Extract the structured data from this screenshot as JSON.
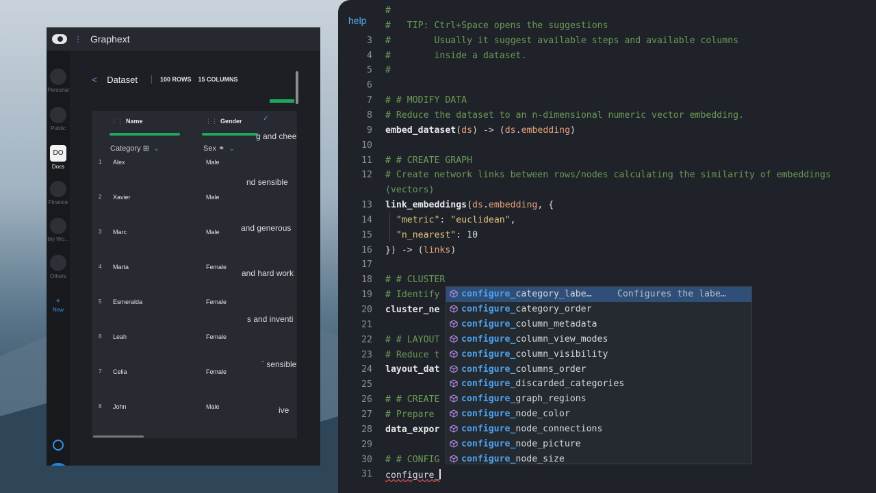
{
  "app": {
    "title": "Graphext",
    "nav": [
      {
        "label": "Personal"
      },
      {
        "label": "Public"
      },
      {
        "label": "Docs",
        "badge": "DO"
      },
      {
        "label": "Finance"
      },
      {
        "label": "My Wo..."
      },
      {
        "label": "Others"
      },
      {
        "label": "New"
      }
    ],
    "help_button": "?"
  },
  "dataset": {
    "back": "<",
    "title": "Dataset",
    "rows": "100 ROWS",
    "columns": "15 COLUMNS",
    "col_headers": [
      {
        "name": "Name",
        "type": "Category"
      },
      {
        "name": "Gender",
        "type": "Sex"
      }
    ],
    "rows_data": [
      {
        "idx": "1",
        "name": "Alex",
        "sex": "Male"
      },
      {
        "idx": "2",
        "name": "Xavier",
        "sex": "Male"
      },
      {
        "idx": "3",
        "name": "Marc",
        "sex": "Male"
      },
      {
        "idx": "4",
        "name": "Marta",
        "sex": "Female"
      },
      {
        "idx": "5",
        "name": "Esmeralda",
        "sex": "Female"
      },
      {
        "idx": "6",
        "name": "Leah",
        "sex": "Female"
      },
      {
        "idx": "7",
        "name": "Celia",
        "sex": "Female"
      },
      {
        "idx": "8",
        "name": "John",
        "sex": "Male"
      }
    ],
    "overflow_texts": [
      "g and chee",
      "nd sensible",
      "and generous",
      "and hard work",
      "s and inventi",
      "` sensible",
      "ive"
    ]
  },
  "editor": {
    "help": "help",
    "lines": [
      {
        "n": "",
        "parts": [
          {
            "c": "cm",
            "t": "#"
          }
        ]
      },
      {
        "n": "",
        "parts": [
          {
            "c": "cm",
            "t": "#   TIP: Ctrl+Space opens the suggestions"
          }
        ]
      },
      {
        "n": "3",
        "parts": [
          {
            "c": "cm",
            "t": "#        Usually it suggest available steps and available columns"
          }
        ]
      },
      {
        "n": "4",
        "parts": [
          {
            "c": "cm",
            "t": "#        inside a dataset."
          }
        ]
      },
      {
        "n": "5",
        "parts": [
          {
            "c": "cm",
            "t": "#"
          }
        ]
      },
      {
        "n": "6",
        "parts": []
      },
      {
        "n": "7",
        "parts": [
          {
            "c": "cm",
            "t": "# # MODIFY DATA"
          }
        ]
      },
      {
        "n": "8",
        "parts": [
          {
            "c": "cm",
            "t": "# Reduce the dataset to an n-dimensional numeric vector embedding."
          }
        ]
      },
      {
        "n": "9",
        "parts": [
          {
            "c": "fn",
            "t": "embed_dataset"
          },
          {
            "c": "",
            "t": "("
          },
          {
            "c": "var",
            "t": "ds"
          },
          {
            "c": "",
            "t": ") "
          },
          {
            "c": "arrow",
            "t": "->"
          },
          {
            "c": "",
            "t": " ("
          },
          {
            "c": "var",
            "t": "ds"
          },
          {
            "c": "",
            "t": "."
          },
          {
            "c": "var",
            "t": "embedding"
          },
          {
            "c": "",
            "t": ")"
          }
        ]
      },
      {
        "n": "10",
        "parts": []
      },
      {
        "n": "11",
        "parts": [
          {
            "c": "cm",
            "t": "# # CREATE GRAPH"
          }
        ]
      },
      {
        "n": "12",
        "parts": [
          {
            "c": "cm",
            "t": "# Create network links between rows/nodes calculating the similarity of embeddings"
          }
        ]
      },
      {
        "n": "",
        "parts": [
          {
            "c": "cm",
            "t": "(vectors)"
          }
        ]
      },
      {
        "n": "13",
        "parts": [
          {
            "c": "fn",
            "t": "link_embeddings"
          },
          {
            "c": "",
            "t": "("
          },
          {
            "c": "var",
            "t": "ds"
          },
          {
            "c": "",
            "t": "."
          },
          {
            "c": "var",
            "t": "embedding"
          },
          {
            "c": "",
            "t": ", {"
          }
        ]
      },
      {
        "n": "14",
        "parts": [
          {
            "c": "",
            "t": "  "
          },
          {
            "c": "str",
            "t": "\"metric\""
          },
          {
            "c": "",
            "t": ": "
          },
          {
            "c": "str",
            "t": "\"euclidean\""
          },
          {
            "c": "",
            "t": ","
          }
        ]
      },
      {
        "n": "15",
        "parts": [
          {
            "c": "",
            "t": "  "
          },
          {
            "c": "str",
            "t": "\"n_nearest\""
          },
          {
            "c": "",
            "t": ": "
          },
          {
            "c": "num",
            "t": "10"
          }
        ]
      },
      {
        "n": "16",
        "parts": [
          {
            "c": "",
            "t": "}) "
          },
          {
            "c": "arrow",
            "t": "->"
          },
          {
            "c": "",
            "t": " ("
          },
          {
            "c": "var",
            "t": "links"
          },
          {
            "c": "",
            "t": ")"
          }
        ]
      },
      {
        "n": "17",
        "parts": []
      },
      {
        "n": "18",
        "parts": [
          {
            "c": "cm",
            "t": "# # CLUSTER"
          }
        ]
      },
      {
        "n": "19",
        "parts": [
          {
            "c": "cm",
            "t": "# Identify"
          }
        ]
      },
      {
        "n": "20",
        "parts": [
          {
            "c": "fn",
            "t": "cluster_ne"
          }
        ]
      },
      {
        "n": "21",
        "parts": []
      },
      {
        "n": "22",
        "parts": [
          {
            "c": "cm",
            "t": "# # LAYOUT"
          }
        ]
      },
      {
        "n": "23",
        "parts": [
          {
            "c": "cm",
            "t": "# Reduce t                                     y node positions"
          }
        ]
      },
      {
        "n": "24",
        "parts": [
          {
            "c": "fn",
            "t": "layout_dat"
          }
        ]
      },
      {
        "n": "25",
        "parts": []
      },
      {
        "n": "26",
        "parts": [
          {
            "c": "cm",
            "t": "# # CREATE"
          }
        ]
      },
      {
        "n": "27",
        "parts": [
          {
            "c": "cm",
            "t": "# Prepare"
          }
        ]
      },
      {
        "n": "28",
        "parts": [
          {
            "c": "fn",
            "t": "data_expor"
          }
        ]
      },
      {
        "n": "29",
        "parts": []
      },
      {
        "n": "30",
        "parts": [
          {
            "c": "cm",
            "t": "# # CONFIG"
          }
        ]
      },
      {
        "n": "31",
        "parts": [
          {
            "c": "squig",
            "t": "configure_"
          },
          {
            "c": "cursor",
            "t": ""
          }
        ]
      }
    ],
    "suggestions": {
      "prefix": "configure_",
      "items": [
        {
          "rest": "category_labe…",
          "desc": "Configures the labe…",
          "selected": true
        },
        {
          "rest": "category_order",
          "desc": "",
          "selected": false
        },
        {
          "rest": "column_metadata",
          "desc": "",
          "selected": false
        },
        {
          "rest": "column_view_modes",
          "desc": "",
          "selected": false
        },
        {
          "rest": "column_visibility",
          "desc": "",
          "selected": false
        },
        {
          "rest": "columns_order",
          "desc": "",
          "selected": false
        },
        {
          "rest": "discarded_categories",
          "desc": "",
          "selected": false
        },
        {
          "rest": "graph_regions",
          "desc": "",
          "selected": false
        },
        {
          "rest": "node_color",
          "desc": "",
          "selected": false
        },
        {
          "rest": "node_connections",
          "desc": "",
          "selected": false
        },
        {
          "rest": "node_picture",
          "desc": "",
          "selected": false
        },
        {
          "rest": "node_size",
          "desc": "",
          "selected": false
        }
      ]
    }
  },
  "colors": {
    "accent": "#3c8fe8",
    "green": "#1fa85a",
    "suggestion_icon": "#b28be6"
  }
}
